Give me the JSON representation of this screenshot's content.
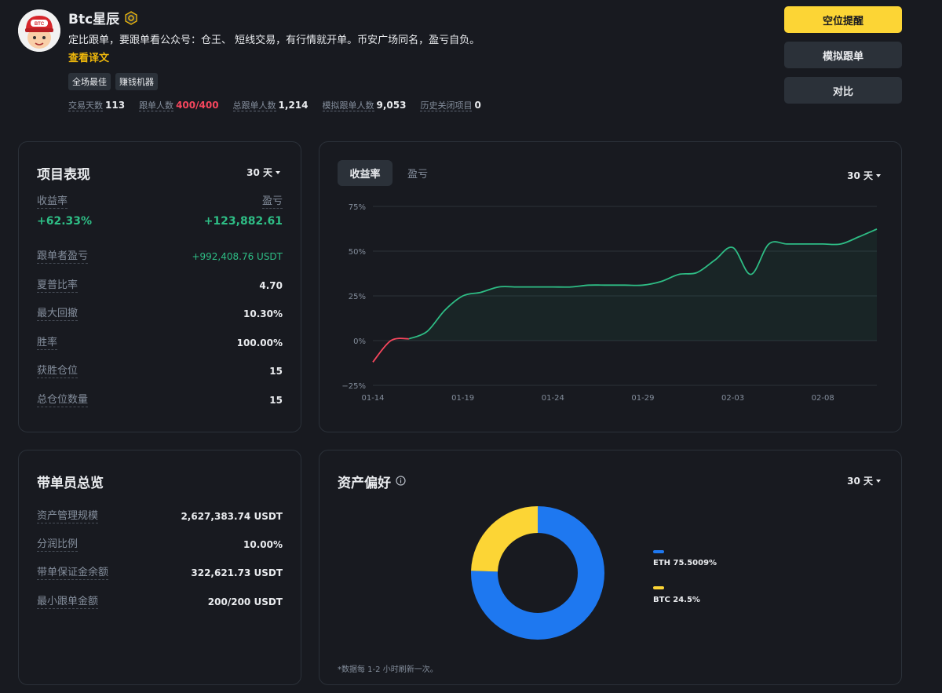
{
  "profile": {
    "name": "Btc星辰",
    "avatar_text": "BTC",
    "bio": "定比跟单，要跟单看公众号：仓王、 短线交易，有行情就开单。币安广场同名，盈亏自负。",
    "translate_link": "查看译文",
    "tags": [
      "全场最佳",
      "赚钱机器"
    ],
    "stats": {
      "trading_days_label": "交易天数",
      "trading_days": "113",
      "copiers_label": "跟单人数",
      "copiers": "400/400",
      "total_copiers_label": "总跟单人数",
      "total_copiers": "1,214",
      "mock_copiers_label": "模拟跟单人数",
      "mock_copiers": "9,053",
      "closed_label": "历史关闭项目",
      "closed": "0"
    }
  },
  "actions": {
    "short_alert": "空位提醒",
    "mock_copy": "模拟跟单",
    "compare": "对比"
  },
  "performance": {
    "title": "项目表现",
    "period": "30 天",
    "roi_label": "收益率",
    "roi_value": "+62.33%",
    "pnl_label": "盈亏",
    "pnl_value": "+123,882.61",
    "rows": [
      {
        "label": "跟单者盈亏",
        "value": "+992,408.76 USDT"
      },
      {
        "label": "夏普比率",
        "value": "4.70"
      },
      {
        "label": "最大回撤",
        "value": "10.30%"
      },
      {
        "label": "胜率",
        "value": "100.00%"
      },
      {
        "label": "获胜仓位",
        "value": "15"
      },
      {
        "label": "总仓位数量",
        "value": "15"
      }
    ]
  },
  "chart_panel": {
    "tab_roi": "收益率",
    "tab_pnl": "盈亏",
    "period": "30 天"
  },
  "chart_data": {
    "type": "line",
    "x": [
      "01-14",
      "01-15",
      "01-16",
      "01-17",
      "01-18",
      "01-19",
      "01-20",
      "01-21",
      "01-22",
      "01-23",
      "01-24",
      "01-25",
      "01-26",
      "01-27",
      "01-28",
      "01-29",
      "01-30",
      "01-31",
      "02-01",
      "02-02",
      "02-03",
      "02-04",
      "02-05",
      "02-06",
      "02-07",
      "02-08",
      "02-09",
      "02-10",
      "02-11"
    ],
    "values": [
      -12,
      0,
      1,
      5,
      17,
      25,
      27,
      30,
      30,
      30,
      30,
      30,
      31,
      31,
      31,
      31,
      33,
      37,
      38,
      45,
      52,
      37,
      54,
      54,
      54,
      54,
      54,
      58,
      62.33
    ],
    "xticks": [
      "01-14",
      "01-19",
      "01-24",
      "01-29",
      "02-03",
      "02-08"
    ],
    "yticks": [
      "75%",
      "50%",
      "25%",
      "0%",
      "−25%"
    ],
    "ylim": [
      -25,
      75
    ],
    "colors": {
      "positive": "#2ebd85",
      "negative": "#f6465d"
    },
    "grid": true
  },
  "overview": {
    "title": "带单员总览",
    "rows": [
      {
        "label": "资产管理规模",
        "value": "2,627,383.74 USDT"
      },
      {
        "label": "分润比例",
        "value": "10.00%"
      },
      {
        "label": "带单保证金余额",
        "value": "322,621.73 USDT"
      },
      {
        "label": "最小跟单金额",
        "value": "200/200 USDT"
      }
    ]
  },
  "assets": {
    "title": "资产偏好",
    "period": "30 天",
    "slices": [
      {
        "name": "ETH",
        "label": "ETH 75.5009%",
        "value": 75.5009,
        "color": "#1e78f0"
      },
      {
        "name": "BTC",
        "label": "BTC 24.5%",
        "value": 24.5,
        "color": "#fcd535"
      }
    ],
    "footnote": "*数据每 1-2 小时刷新一次。"
  }
}
